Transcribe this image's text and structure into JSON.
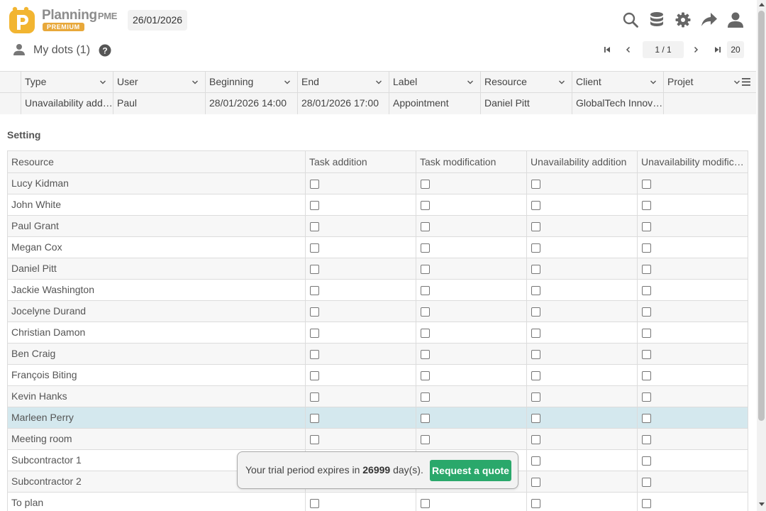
{
  "app": {
    "brand_main": "Planning",
    "brand_suffix": "PME",
    "badge": "PREMIUM",
    "current_date": "26/01/2026"
  },
  "header_icons": [
    "search-icon",
    "database-icon",
    "gear-icon",
    "share-icon",
    "user-icon"
  ],
  "view": {
    "title": "My dots (1)",
    "help_glyph": "?"
  },
  "pager": {
    "page": "1 / 1",
    "page_size": "20"
  },
  "dots_table": {
    "columns": [
      "Type",
      "User",
      "Beginning",
      "End",
      "Label",
      "Resource",
      "Client",
      "Projet"
    ],
    "rows": [
      [
        "Unavailability addition",
        "Paul",
        "28/01/2026 14:00",
        "28/01/2026 17:00",
        "Appointment",
        "Daniel Pitt",
        "GlobalTech Innovations",
        ""
      ]
    ]
  },
  "setting": {
    "label": "Setting",
    "columns": [
      "Resource",
      "Task addition",
      "Task modification",
      "Unavailability addition",
      "Unavailability modification"
    ],
    "resources": [
      "Lucy Kidman",
      "John White",
      "Paul Grant",
      "Megan Cox",
      "Daniel Pitt",
      "Jackie Washington",
      "Jocelyne Durand",
      "Christian Damon",
      "Ben Craig",
      "François Biting",
      "Kevin Hanks",
      "Marleen Perry",
      "Meeting room",
      "Subcontractor 1",
      "Subcontractor 2",
      "To plan"
    ],
    "selected_resource": "Marleen Perry"
  },
  "trial": {
    "text_before": "Your trial period expires in ",
    "days": "26999",
    "text_after": " day(s).",
    "button_label": "Request a quote"
  },
  "colors": {
    "accent_green": "#2aa86b",
    "badge_orange": "#e8a83a",
    "logo_yellow": "#f2b531",
    "selected_row": "#d4e8ee"
  }
}
